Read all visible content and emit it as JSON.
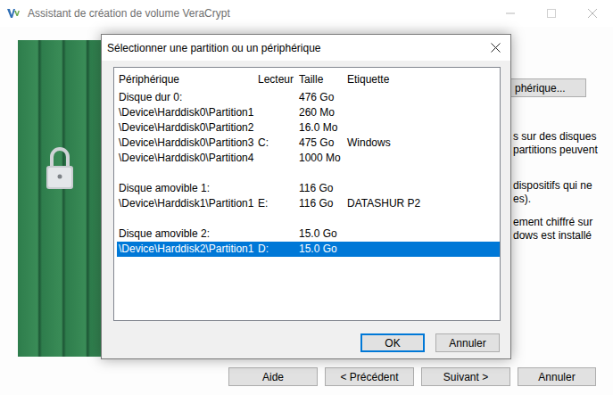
{
  "window": {
    "title": "Assistant de création de volume VeraCrypt"
  },
  "background": {
    "device_button": "phérique...",
    "paragraphs": [
      [
        "s sur des disques",
        "partitions peuvent"
      ],
      [
        "dispositifs qui ne",
        "es)."
      ],
      [
        "ement chiffré sur",
        "dows est installé"
      ]
    ]
  },
  "buttons": [
    {
      "label": "Aide"
    },
    {
      "label": "< Précédent"
    },
    {
      "label": "Suivant >"
    },
    {
      "label": "Annuler"
    }
  ],
  "dialog": {
    "title": "Sélectionner une partition ou un périphérique",
    "columns": [
      "Périphérique",
      "Lecteur",
      "Taille",
      "Etiquette"
    ],
    "groups": [
      {
        "device": "Disque dur 0:",
        "size": "476 Go",
        "selected": false,
        "partitions": [
          {
            "device": "\\Device\\Harddisk0\\Partition1",
            "drive": "",
            "size": "260 Mo",
            "label": "",
            "selected": false
          },
          {
            "device": "\\Device\\Harddisk0\\Partition2",
            "drive": "",
            "size": "16.0 Mo",
            "label": "",
            "selected": false
          },
          {
            "device": "\\Device\\Harddisk0\\Partition3",
            "drive": "C:",
            "size": "475 Go",
            "label": "Windows",
            "selected": false
          },
          {
            "device": "\\Device\\Harddisk0\\Partition4",
            "drive": "",
            "size": "1000 Mo",
            "label": "",
            "selected": false
          }
        ]
      },
      {
        "device": "Disque amovible 1:",
        "size": "116 Go",
        "selected": false,
        "partitions": [
          {
            "device": "\\Device\\Harddisk1\\Partition1",
            "drive": "E:",
            "size": "116 Go",
            "label": "DATASHUR P2",
            "selected": false
          }
        ]
      },
      {
        "device": "Disque amovible 2:",
        "size": "15.0 Go",
        "selected": false,
        "partitions": [
          {
            "device": "\\Device\\Harddisk2\\Partition1",
            "drive": "D:",
            "size": "15.0 Go",
            "label": "",
            "selected": true
          }
        ]
      }
    ],
    "buttons": [
      {
        "label": "OK",
        "default": true
      },
      {
        "label": "Annuler",
        "default": false
      }
    ]
  }
}
